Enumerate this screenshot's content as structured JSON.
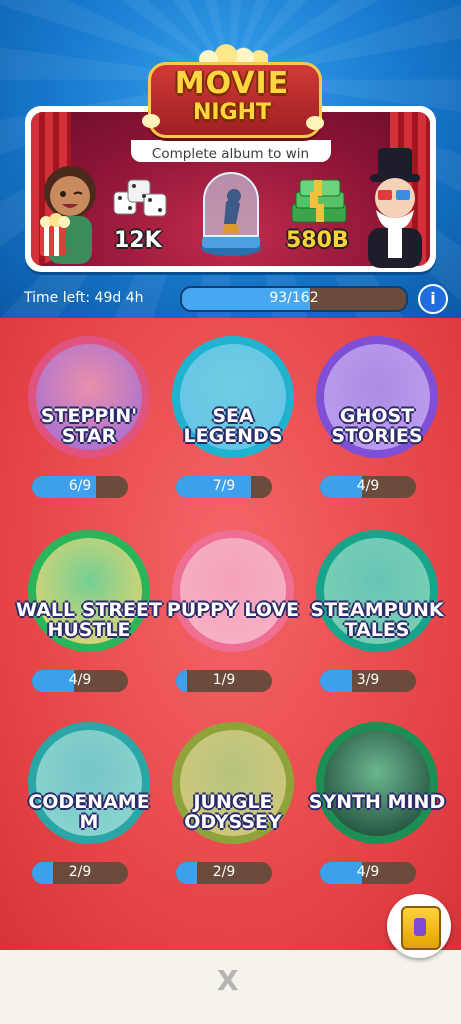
{
  "header": {
    "logo_line1": "MOVIE",
    "logo_line2": "NIGHT",
    "subtitle": "Complete album to win",
    "reward_dice": "12K",
    "reward_cash": "580B"
  },
  "timer": {
    "label": "Time left: 49d 4h",
    "progress_text": "93/162",
    "progress_fraction": 0.574
  },
  "albums": [
    {
      "title1": "STEPPIN'",
      "title2": "STAR",
      "progress": "6/9",
      "fraction": 0.667,
      "ring": "#e0537e",
      "bg": "#9a6ad8"
    },
    {
      "title1": "SEA",
      "title2": "LEGENDS",
      "progress": "7/9",
      "fraction": 0.778,
      "ring": "#1fb3d0",
      "bg": "#63c3e8"
    },
    {
      "title1": "GHOST",
      "title2": "STORIES",
      "progress": "4/9",
      "fraction": 0.444,
      "ring": "#7f4fd6",
      "bg": "#bfa0f0"
    },
    {
      "title1": "WALL STREET",
      "title2": "HUSTLE",
      "progress": "4/9",
      "fraction": 0.444,
      "ring": "#2bb55b",
      "bg": "#f4d66a"
    },
    {
      "title1": "PUPPY LOVE",
      "title2": "",
      "progress": "1/9",
      "fraction": 0.111,
      "ring": "#ef6f93",
      "bg": "#f6b4c8"
    },
    {
      "title1": "STEAMPUNK",
      "title2": "TALES",
      "progress": "3/9",
      "fraction": 0.333,
      "ring": "#16a58a",
      "bg": "#7ed2b6"
    },
    {
      "title1": "CODENAME",
      "title2": "M",
      "progress": "2/9",
      "fraction": 0.222,
      "ring": "#2aa6a6",
      "bg": "#8fd8d4"
    },
    {
      "title1": "JUNGLE",
      "title2": "ODYSSEY",
      "progress": "2/9",
      "fraction": 0.222,
      "ring": "#8ea43a",
      "bg": "#d7c87a"
    },
    {
      "title1": "SYNTH MIND",
      "title2": "",
      "progress": "4/9",
      "fraction": 0.444,
      "ring": "#1c8f54",
      "bg": "#123a2a"
    }
  ],
  "footer": {
    "close_symbol": "X"
  }
}
